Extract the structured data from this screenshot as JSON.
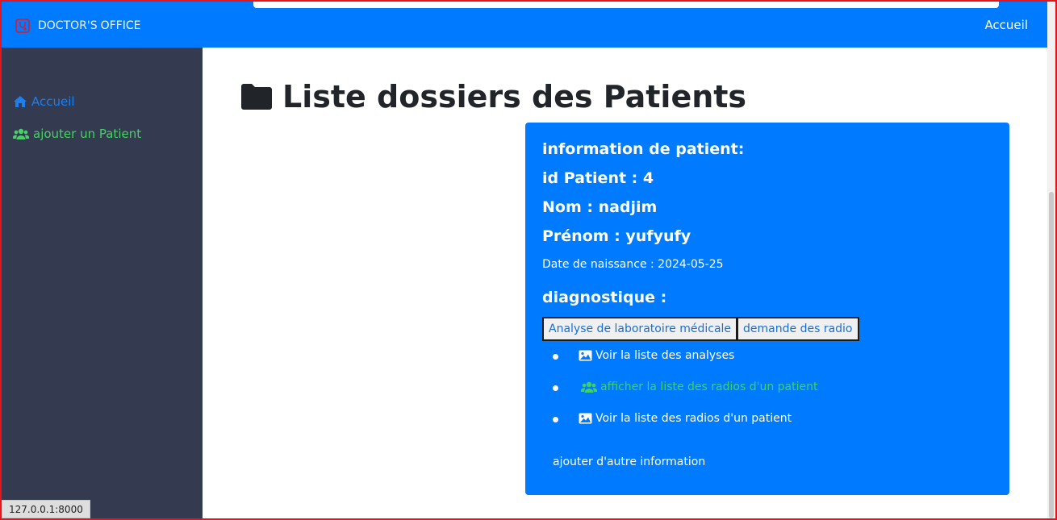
{
  "header": {
    "brand_part1": "DOCTOR'S",
    "brand_part2": "OFFICE",
    "nav_home": "Accueil"
  },
  "sidebar": {
    "items": [
      {
        "label": "Accueil",
        "icon": "home-icon",
        "color": "#1b7ff0"
      },
      {
        "label": "ajouter un Patient",
        "icon": "users-icon",
        "color": "#47d167"
      }
    ]
  },
  "status_bar": {
    "url": "127.0.0.1:8000"
  },
  "main": {
    "title": "Liste dossiers des Patients",
    "title_icon": "folder-icon"
  },
  "patient_card": {
    "heading": "information de patient:",
    "id_line": "id Patient : 4",
    "nom_line": "Nom : nadjim",
    "prenom_line": "Prénom : yufyufy",
    "birth_line": "Date de naissance : 2024-05-25",
    "diag_heading": "diagnostique :",
    "buttons": [
      "Analyse de laboratoire médicale",
      "demande des radio"
    ],
    "links": [
      {
        "label": "Voir la liste des analyses",
        "icon": "image-icon"
      },
      {
        "label": "afficher la liste des radios d'un patient",
        "icon": "users-icon"
      },
      {
        "label": "Voir la liste des radios d'un patient",
        "icon": "image-icon"
      }
    ],
    "extra_link": "ajouter d'autre information",
    "accent_color": "#007bff"
  }
}
